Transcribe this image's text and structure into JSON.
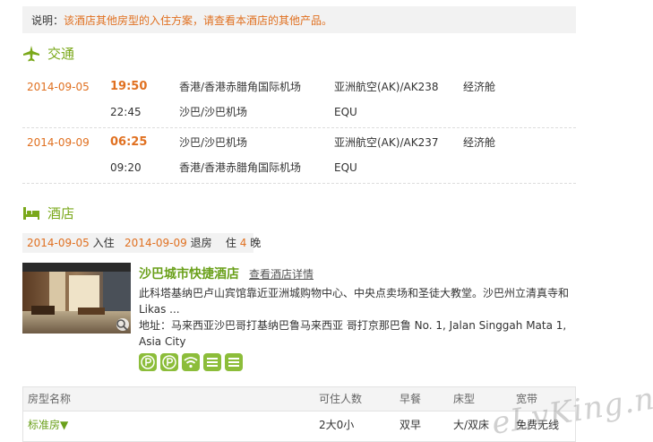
{
  "note": {
    "label": "说明：",
    "text": "该酒店其他房型的入住方案，请查看本酒店的其他产品。"
  },
  "transport": {
    "title": "交通",
    "flights": [
      {
        "date": "2014-09-05",
        "dep_time": "19:50",
        "dep_airport": "香港/香港赤腊角国际机场",
        "flight": "亚洲航空(AK)/AK238",
        "class": "经济舱",
        "arr_time": "22:45",
        "arr_airport": "沙巴/沙巴机场",
        "aircraft": "EQU"
      },
      {
        "date": "2014-09-09",
        "dep_time": "06:25",
        "dep_airport": "沙巴/沙巴机场",
        "flight": "亚洲航空(AK)/AK237",
        "class": "经济舱",
        "arr_time": "09:20",
        "arr_airport": "香港/香港赤腊角国际机场",
        "aircraft": "EQU"
      }
    ]
  },
  "hotel_section": {
    "title": "酒店",
    "checkin_date": "2014-09-05",
    "checkin_label": "入住",
    "checkout_date": "2014-09-09",
    "checkout_label": "退房",
    "stay_prefix": "住",
    "nights": "4",
    "stay_suffix": "晚"
  },
  "hotel": {
    "name": "沙巴城市快捷酒店",
    "detail_link": "查看酒店详情",
    "description": "此科塔基纳巴卢山宾馆靠近亚洲城购物中心、中央点卖场和圣徒大教堂。沙巴州立清真寺和Likas ...",
    "address": "地址：马来西亚沙巴哥打基纳巴鲁马来西亚 哥打京那巴鲁 No. 1, Jalan Singgah Mata 1, Asia City",
    "amenities": [
      "parking-icon",
      "parking-icon",
      "wifi-icon",
      "restaurant-icon",
      "restaurant-icon"
    ]
  },
  "rooms": {
    "headers": [
      "房型名称",
      "可住人数",
      "早餐",
      "床型",
      "宽带"
    ],
    "rows": [
      {
        "type": "标准房▼",
        "occupancy": "2大0小",
        "breakfast": "双早",
        "bed": "大/双床",
        "broadband": "免费无线"
      }
    ]
  },
  "watermark": "eLvKing.net",
  "colors": {
    "accent": "#7aa81a",
    "orange": "#e07020"
  }
}
